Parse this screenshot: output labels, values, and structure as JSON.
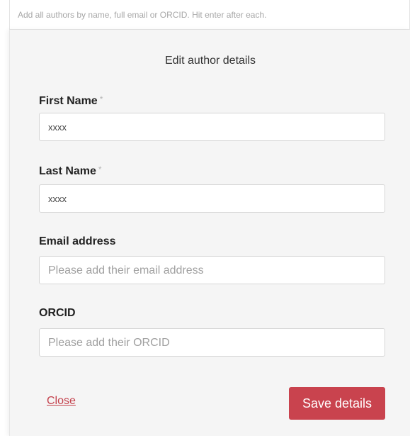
{
  "author_search": {
    "placeholder": "Add all authors by name, full email or ORCID. Hit enter after each."
  },
  "modal": {
    "title": "Edit author details",
    "required_marker": "*",
    "fields": {
      "first_name": {
        "label": "First Name",
        "value": "xxxx",
        "required": true
      },
      "last_name": {
        "label": "Last Name",
        "value": "xxxx",
        "required": true
      },
      "email": {
        "label": "Email address",
        "value": "",
        "placeholder": "Please add their email address"
      },
      "orcid": {
        "label": "ORCID",
        "value": "",
        "placeholder": "Please add their ORCID"
      }
    },
    "close_label": "Close",
    "save_label": "Save details"
  },
  "colors": {
    "accent": "#c9434e",
    "panel_background": "#f5f5f5"
  }
}
